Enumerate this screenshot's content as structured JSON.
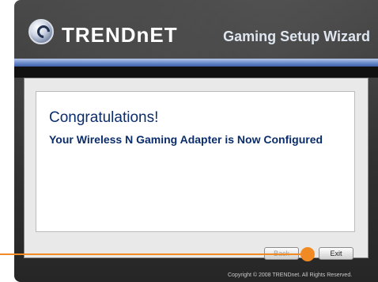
{
  "header": {
    "brand": "TRENDnET",
    "wizard_title": "Gaming Setup Wizard"
  },
  "main": {
    "heading": "Congratulations!",
    "message": "Your Wireless N Gaming Adapter is Now Configured"
  },
  "footer": {
    "back_label": "Back",
    "exit_label": "Exit",
    "copyright": "Copyright © 2008 TRENDnet. All Rights Reserved."
  },
  "colors": {
    "accent": "#f28a24",
    "header_blue": "#3c5fa9",
    "text_blue": "#0b2d6b"
  }
}
